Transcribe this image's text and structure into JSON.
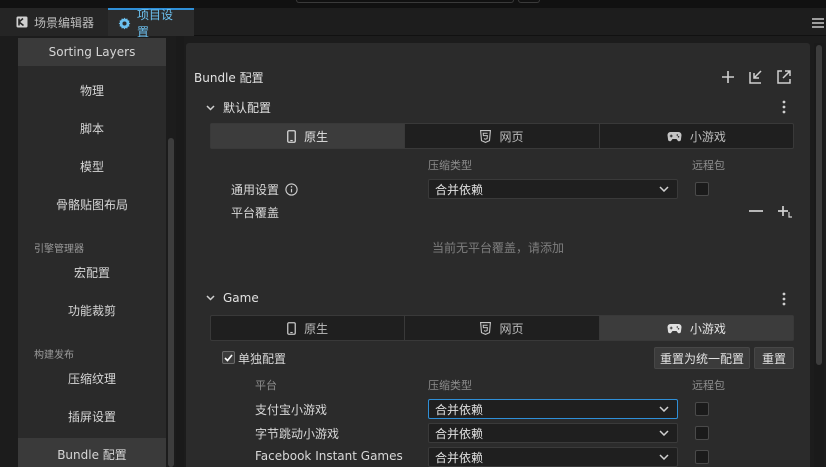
{
  "tabs": [
    {
      "label": "场景编辑器",
      "icon": "scene-editor-icon"
    },
    {
      "label": "项目设置",
      "icon": "gear-icon"
    }
  ],
  "sidebar": {
    "items": [
      {
        "label": "Sorting Layers"
      },
      {
        "label": "物理"
      },
      {
        "label": "脚本"
      },
      {
        "label": "模型"
      },
      {
        "label": "骨骼贴图布局"
      },
      {
        "label": "宏配置"
      },
      {
        "label": "功能裁剪"
      },
      {
        "label": "压缩纹理"
      },
      {
        "label": "插屏设置"
      },
      {
        "label": "Bundle 配置"
      }
    ],
    "groups": [
      "引擎管理器",
      "构建发布"
    ],
    "selected": "Bundle 配置"
  },
  "panel": {
    "title": "Bundle 配置",
    "header_icons": [
      "add-icon",
      "import-icon",
      "export-icon"
    ]
  },
  "platform_tabs": [
    "原生",
    "网页",
    "小游戏"
  ],
  "default_section": {
    "title": "默认配置",
    "active_tab": "原生",
    "col_compression": "压缩类型",
    "col_remote": "远程包",
    "general_label": "通用设置",
    "general_value": "合并依赖",
    "override_label": "平台覆盖",
    "empty_hint": "当前无平台覆盖，请添加"
  },
  "game_section": {
    "title": "Game",
    "active_tab": "小游戏",
    "independent_label": "单独配置",
    "independent_checked": true,
    "reset_unified_label": "重置为统一配置",
    "reset_label": "重置",
    "col_platform": "平台",
    "col_compression": "压缩类型",
    "col_remote": "远程包",
    "rows": [
      {
        "platform": "支付宝小游戏",
        "compression": "合并依赖"
      },
      {
        "platform": "字节跳动小游戏",
        "compression": "合并依赖"
      },
      {
        "platform": "Facebook Instant Games",
        "compression": "合并依赖"
      }
    ]
  },
  "colors": {
    "accent": "#2f8fd7",
    "active_tab_text": "#6cc1f0"
  }
}
